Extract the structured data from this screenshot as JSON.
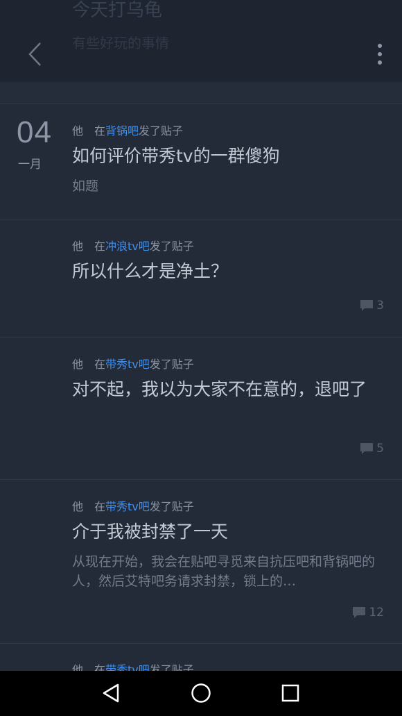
{
  "header": {
    "title": "今天打乌龟",
    "subtitle": "有些好玩的事情"
  },
  "date": {
    "day": "04",
    "month": "一月"
  },
  "posts": [
    {
      "actor": "他",
      "prefix": "在",
      "forum": "背锅吧",
      "suffix": "发了贴子",
      "title": "如何评价带秀tv的一群傻狗",
      "excerpt": "如题",
      "comments": ""
    },
    {
      "actor": "他",
      "prefix": "在",
      "forum": "冲浪tv吧",
      "suffix": "发了贴子",
      "title": "所以什么才是净土？",
      "excerpt": "",
      "comments": "3"
    },
    {
      "actor": "他",
      "prefix": "在",
      "forum": "带秀tv吧",
      "suffix": "发了贴子",
      "title": "对不起，我以为大家不在意的，退吧了",
      "excerpt": "",
      "comments": "5"
    },
    {
      "actor": "他",
      "prefix": "在",
      "forum": "带秀tv吧",
      "suffix": "发了贴子",
      "title": "介于我被封禁了一天",
      "excerpt": "从现在开始，我会在贴吧寻觅来自抗压吧和背锅吧的人，然后艾特吧务请求封禁，锁上的…",
      "comments": "12"
    },
    {
      "actor": "他",
      "prefix": "在",
      "forum": "带秀tv吧",
      "suffix": "发了贴子",
      "title": "",
      "excerpt": "",
      "comments": ""
    }
  ],
  "icons": {
    "back": "chevron-left-icon",
    "more": "more-vertical-icon",
    "comment": "comment-bubble-icon",
    "nav_back": "triangle-back-icon",
    "nav_home": "circle-home-icon",
    "nav_recents": "square-recents-icon"
  },
  "colors": {
    "background": "#232b38",
    "forum_link": "#3f8ff0",
    "title_text": "#c3cad5"
  }
}
